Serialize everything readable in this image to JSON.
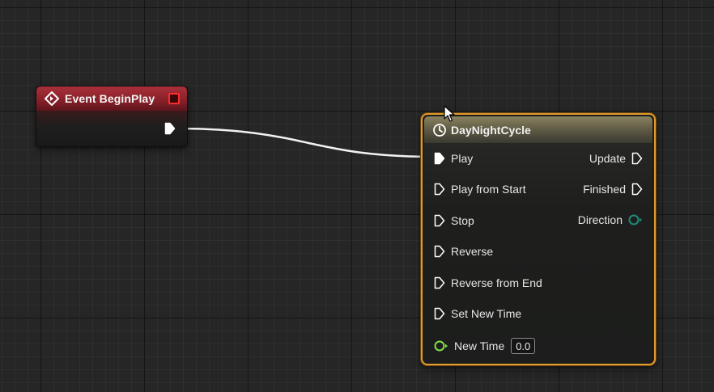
{
  "event_node": {
    "title": "Event BeginPlay",
    "header_color": "#862029",
    "delegate_color": "#ff2a2a",
    "icon": "event-diamond-icon",
    "output_pin": "exec-out-pin"
  },
  "timeline_node": {
    "title": "DayNightCycle",
    "icon": "clock-icon",
    "border_color": "#e19b2c",
    "inputs": [
      {
        "label": "Play",
        "pin": "exec-pin",
        "connected": true
      },
      {
        "label": "Play from Start",
        "pin": "exec-pin",
        "connected": false
      },
      {
        "label": "Stop",
        "pin": "exec-pin",
        "connected": false
      },
      {
        "label": "Reverse",
        "pin": "exec-pin",
        "connected": false
      },
      {
        "label": "Reverse from End",
        "pin": "exec-pin",
        "connected": false
      },
      {
        "label": "Set New Time",
        "pin": "exec-pin",
        "connected": false
      },
      {
        "label": "New Time",
        "pin": "float-pin",
        "value": "0.0",
        "pin_color": "#7fe04f"
      }
    ],
    "outputs": [
      {
        "label": "Update",
        "pin": "exec-pin"
      },
      {
        "label": "Finished",
        "pin": "exec-pin"
      },
      {
        "label": "Direction",
        "pin": "enum-pin",
        "pin_color": "#1f8a7a"
      }
    ]
  },
  "wire": {
    "from": "event_node.exec-out-pin",
    "to": "timeline_node.inputs.0",
    "color": "#ffffff"
  }
}
